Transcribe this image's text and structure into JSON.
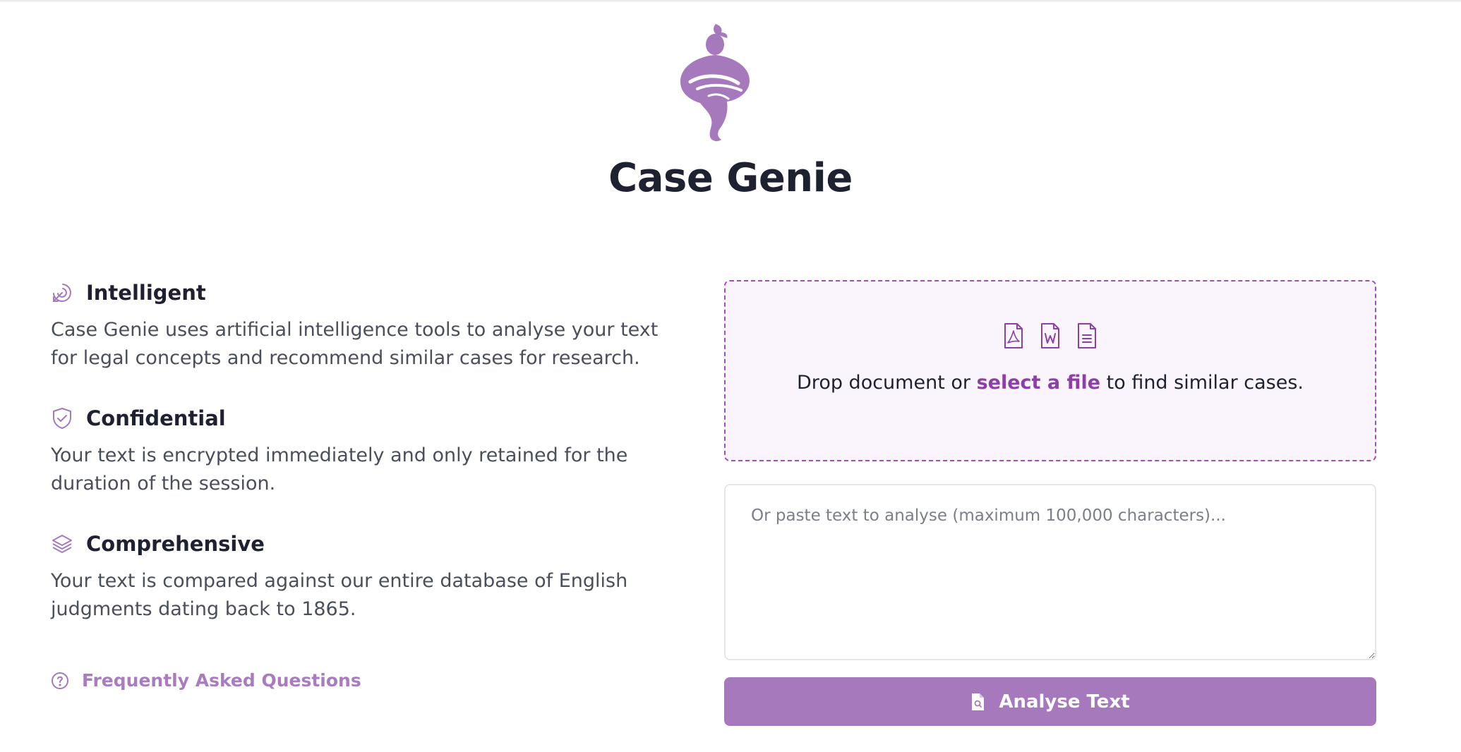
{
  "app": {
    "title": "Case Genie",
    "brand_color": "#a679bd",
    "accent_color": "#8c3fa6",
    "logo_icon": "genie-logo-icon"
  },
  "features": [
    {
      "icon": "target-arrow-icon",
      "title": "Intelligent",
      "description": "Case Genie uses artificial intelligence tools to analyse your text for legal concepts and recommend similar cases for research."
    },
    {
      "icon": "shield-check-icon",
      "title": "Confidential",
      "description": "Your text is encrypted immediately and only retained for the duration of the session."
    },
    {
      "icon": "layers-icon",
      "title": "Comprehensive",
      "description": "Your text is compared against our entire database of English judgments dating back to 1865."
    }
  ],
  "faq": {
    "icon": "question-circle-icon",
    "label": "Frequently Asked Questions"
  },
  "dropzone": {
    "file_icons": [
      "pdf-file-icon",
      "word-file-icon",
      "text-file-icon"
    ],
    "text_before": "Drop document or ",
    "link_text": "select a file",
    "text_after": " to find similar cases."
  },
  "paste": {
    "placeholder": "Or paste text to analyse (maximum 100,000 characters)...",
    "value": ""
  },
  "analyse_button": {
    "icon": "file-search-icon",
    "label": "Analyse Text"
  }
}
